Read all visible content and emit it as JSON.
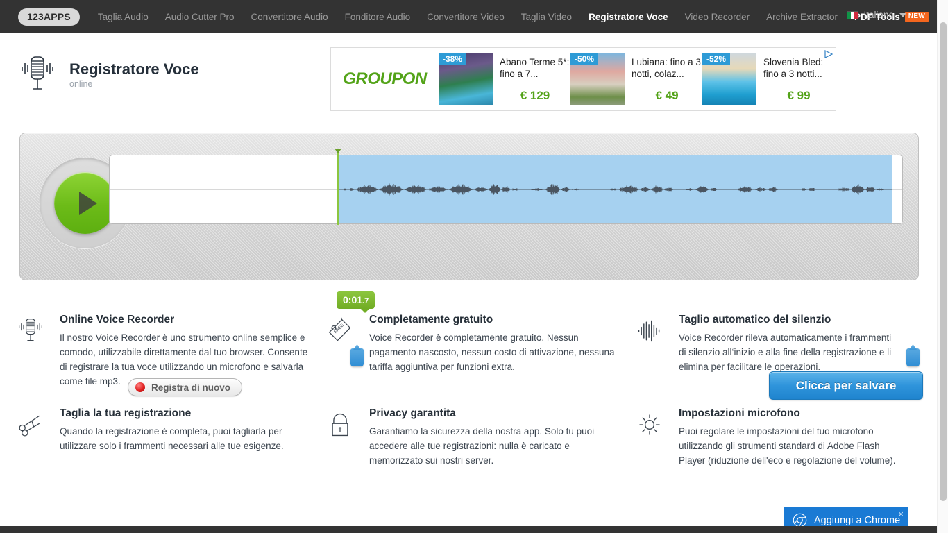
{
  "nav": {
    "logo": "123APPS",
    "items": [
      {
        "label": "Taglia Audio",
        "state": "normal"
      },
      {
        "label": "Audio Cutter Pro",
        "state": "normal"
      },
      {
        "label": "Convertitore Audio",
        "state": "normal"
      },
      {
        "label": "Fonditore Audio",
        "state": "normal"
      },
      {
        "label": "Convertitore Video",
        "state": "normal"
      },
      {
        "label": "Taglia Video",
        "state": "normal"
      },
      {
        "label": "Registratore Voce",
        "state": "active"
      },
      {
        "label": "Video Recorder",
        "state": "normal"
      },
      {
        "label": "Archive Extractor",
        "state": "normal"
      },
      {
        "label": "PDF Tools",
        "state": "strong"
      }
    ],
    "new_badge": "NEW",
    "language": "Italiano",
    "language_flag": "italy-flag",
    "colors": {
      "bar": "#333333",
      "active": "#ffffff",
      "inactive": "#9a9a9a",
      "badge": "#f4661e"
    }
  },
  "header": {
    "title": "Registratore Voce",
    "subtitle": "online",
    "icon": "microphone-icon"
  },
  "ad": {
    "brand": "GROUPON",
    "label": "ad-choices-icon",
    "items": [
      {
        "discount": "-38%",
        "title": "Abano Terme 5*: fino a 7...",
        "price": "€ 129"
      },
      {
        "discount": "-50%",
        "title": "Lubiana: fino a 3 notti, colaz...",
        "price": "€ 49"
      },
      {
        "discount": "-52%",
        "title": "Slovenia Bled: fino a 3 notti...",
        "price": "€ 99"
      }
    ]
  },
  "player": {
    "play_button": "play-icon",
    "time_marker_min": "0:01",
    "time_marker_frac": ".7",
    "record_again_label": "Registra di nuovo",
    "save_label": "Clicca per salvare",
    "left_handle": "selection-handle-left",
    "right_handle": "selection-handle-right",
    "accent_green": "#8cc63e",
    "accent_blue": "#2f94db",
    "selection_fill": "#a6d1f0"
  },
  "features": [
    {
      "icon": "microphone-icon",
      "title": "Online Voice Recorder",
      "desc": "Il nostro Voice Recorder è uno strumento online semplice e comodo, utilizzabile direttamente dal tuo browser. Consente di registrare la tua voce utilizzando un microfono e salvarla come file mp3."
    },
    {
      "icon": "free-tag-icon",
      "title": "Completamente gratuito",
      "desc": "Voice Recorder è completamente gratuito. Nessun pagamento nascosto, nessun costo di attivazione, nessuna tariffa aggiuntiva per funzioni extra."
    },
    {
      "icon": "waveform-icon",
      "title": "Taglio automatico del silenzio",
      "desc": "Voice Recorder rileva automaticamente i frammenti di silenzio all‘inizio e alla fine della registrazione e li elimina per facilitare le operazioni."
    },
    {
      "icon": "scissors-icon",
      "title": "Taglia la tua registrazione",
      "desc": "Quando la registrazione è completa, puoi tagliarla per utilizzare solo i frammenti necessari alle tue esigenze."
    },
    {
      "icon": "lock-icon",
      "title": "Privacy garantita",
      "desc": "Garantiamo la sicurezza della nostra app. Solo tu puoi accedere alle tue registrazioni: nulla è caricato e memorizzato sui nostri server."
    },
    {
      "icon": "gear-icon",
      "title": "Impostazioni microfono",
      "desc": "Puoi regolare le impostazioni del tuo microfono utilizzando gli strumenti standard di Adobe Flash Player (riduzione dell'eco e regolazione del volume)."
    }
  ],
  "chrome_toast": {
    "label": "Aggiungi a Chrome",
    "icon": "chrome-icon",
    "close": "×",
    "color": "#1a7ad4"
  }
}
